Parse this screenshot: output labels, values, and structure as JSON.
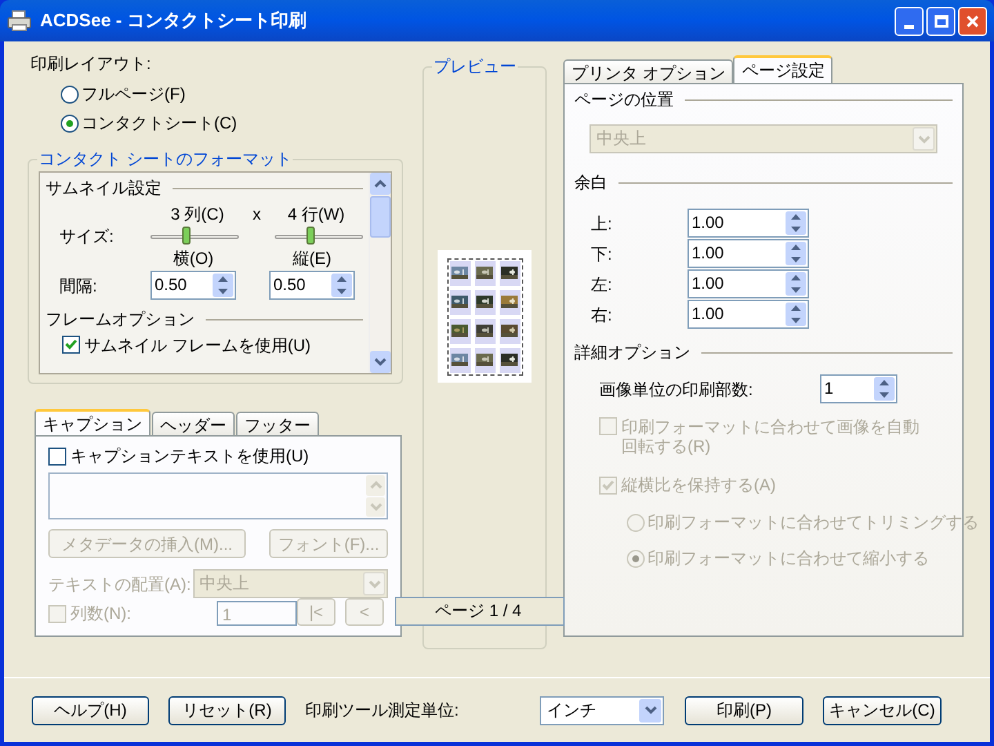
{
  "window": {
    "title": "ACDSee - コンタクトシート印刷"
  },
  "layout": {
    "label": "印刷レイアウト:",
    "options": [
      {
        "label": "フルページ(F)",
        "selected": false
      },
      {
        "label": "コンタクトシート(C)",
        "selected": true
      }
    ]
  },
  "format": {
    "title": "コンタクト シートのフォーマット",
    "thumbnail_section": "サムネイル設定",
    "size_label": "サイズ:",
    "columns": {
      "label": "3 列(C)",
      "level": 0.4
    },
    "times": "x",
    "rows": {
      "label": "4 行(W)",
      "level": 0.4
    },
    "spacing_label": "間隔:",
    "horizontal": {
      "label": "横(O)",
      "value": "0.50"
    },
    "vertical": {
      "label": "縦(E)",
      "value": "0.50"
    },
    "frame_section": "フレームオプション",
    "frame_checkbox": {
      "label": "サムネイル フレームを使用(U)",
      "checked": true
    }
  },
  "caption": {
    "tabs": [
      {
        "label": "キャプション",
        "selected": true
      },
      {
        "label": "ヘッダー",
        "selected": false
      },
      {
        "label": "フッター",
        "selected": false
      }
    ],
    "use_caption": {
      "label": "キャプションテキストを使用(U)",
      "checked": false
    },
    "text_area": {
      "disabled": true
    },
    "insert_metadata": {
      "label": "メタデータの挿入(M)...",
      "disabled": true
    },
    "font": {
      "label": "フォント(F)...",
      "disabled": true
    },
    "alignment_label": "テキストの配置(A):",
    "alignment": {
      "value": "中央上",
      "disabled": true
    },
    "columns_checkbox": {
      "label": "列数(N):",
      "checked": false,
      "disabled": true
    },
    "columns_value": "1"
  },
  "preview": {
    "title": "プレビュー",
    "first_page": "|<",
    "previous_page": "<",
    "page_label": "ページ 1 / 4"
  },
  "settings": {
    "tabs": [
      {
        "label": "プリンタ オプション",
        "selected": false
      },
      {
        "label": "ページ設定",
        "selected": true
      }
    ],
    "position_section": "ページの位置",
    "position": {
      "value": "中央上",
      "disabled": true
    },
    "margin_section": "余白",
    "margins": [
      {
        "label": "上:",
        "value": "1.00"
      },
      {
        "label": "下:",
        "value": "1.00"
      },
      {
        "label": "左:",
        "value": "1.00"
      },
      {
        "label": "右:",
        "value": "1.00"
      }
    ],
    "detail_section": "詳細オプション",
    "copies_label": "画像単位の印刷部数:",
    "copies_value": "1",
    "auto_rotate": {
      "label": "印刷フォーマットに合わせて画像を自動回転する(R)",
      "checked": false,
      "disabled": true
    },
    "keep_aspect": {
      "label": "縦横比を保持する(A)",
      "checked": true,
      "disabled": true
    },
    "fit_options": [
      {
        "label": "印刷フォーマットに合わせてトリミングする",
        "selected": false,
        "disabled": true
      },
      {
        "label": "印刷フォーマットに合わせて縮小する",
        "selected": true,
        "disabled": true
      }
    ]
  },
  "footer": {
    "help": "ヘルプ(H)",
    "reset": "リセット(R)",
    "unit_label": "印刷ツール測定単位:",
    "unit_value": "インチ",
    "print": "印刷(P)",
    "cancel": "キャンセル(C)"
  }
}
